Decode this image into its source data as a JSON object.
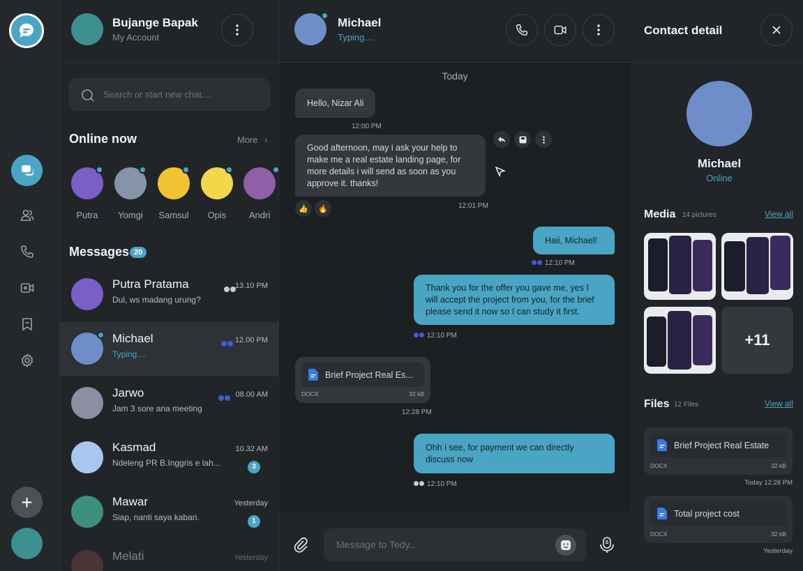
{
  "account": {
    "name": "Bujange Bapak",
    "subtitle": "My Account"
  },
  "search": {
    "placeholder": "Search or start new chat...."
  },
  "online": {
    "title": "Online now",
    "more": "More",
    "users": [
      {
        "name": "Putra",
        "color": "#7b5ec8"
      },
      {
        "name": "Yomgi",
        "color": "#8794a8"
      },
      {
        "name": "Samsul",
        "color": "#f1c231"
      },
      {
        "name": "Opis",
        "color": "#f3d64a"
      },
      {
        "name": "Andri",
        "color": "#8f5fa8"
      }
    ]
  },
  "messages": {
    "title": "Messages",
    "count": "20",
    "chats": [
      {
        "name": "Putra Pratama",
        "preview": "Dul, ws madang urung?",
        "time": "13.10 PM",
        "ticks": "read-grey",
        "color": "#7b5ec8"
      },
      {
        "name": "Michael",
        "preview": "Typing....",
        "time": "12.00 PM",
        "ticks": "read-blue",
        "color": "#6f8dc9"
      },
      {
        "name": "Jarwo",
        "preview": "Jam 3 sore ana meeting",
        "time": "08.00 AM",
        "ticks": "read-blue",
        "color": "#8c8fa3"
      },
      {
        "name": "Kasmad",
        "preview": "Ndeleng PR B.Inggris e lah...",
        "time": "10.32 AM",
        "badge": "3",
        "color": "#a9c7ee"
      },
      {
        "name": "Mawar",
        "preview": "Siap, nanti saya kabari.",
        "time": "Yesterday",
        "badge": "1",
        "color": "#3d8f80"
      },
      {
        "name": "Melati",
        "preview": "",
        "time": "Yesterday",
        "color": "#7a4a44"
      }
    ]
  },
  "chat": {
    "contact": "Michael",
    "status": "Typing....",
    "day": "Today",
    "msg1": {
      "text": "Hello, Nizar Ali",
      "time": "12:00 PM"
    },
    "msg2": {
      "text": "Good afternoon, may i ask your help to make me a real estate landing page, for more details i will send as soon as you approve it. thanks!",
      "time": "12:01 PM",
      "reactions": [
        "👍",
        "🔥"
      ]
    },
    "msg3": {
      "text": "Haii, Michael!",
      "time": "12:10 PM"
    },
    "msg4": {
      "text": "Thank you for the offer you gave me, yes I will accept the project from you, for the brief please send it now so I can study it first.",
      "time": "12:10 PM"
    },
    "file": {
      "name": "Brief Project Real Es...",
      "type": "DOCX",
      "size": "32 kB",
      "time": "12:28 PM"
    },
    "msg5": {
      "text": "Ohh i see, for payment we can directly discuss now",
      "time": "12:10 PM"
    },
    "composer_placeholder": "Message to Tedy..."
  },
  "detail": {
    "title": "Contact detail",
    "name": "Michael",
    "status": "Online",
    "media": {
      "title": "Media",
      "count": "14 pictures",
      "view_all": "View all",
      "more": "+11"
    },
    "files": {
      "title": "Files",
      "count": "12 Files",
      "view_all": "View all",
      "items": [
        {
          "name": "Brief Project Real Estate",
          "type": "DOCX",
          "size": "32 kB",
          "time": "Today 12:28 PM"
        },
        {
          "name": "Total project cost",
          "type": "DOCX",
          "size": "32 kB",
          "time": "Yesterday"
        }
      ]
    }
  },
  "colors": {
    "accent": "#4aa4c4",
    "bg": "#1f2225",
    "panel": "#222528",
    "bubble_in": "#34383c"
  }
}
